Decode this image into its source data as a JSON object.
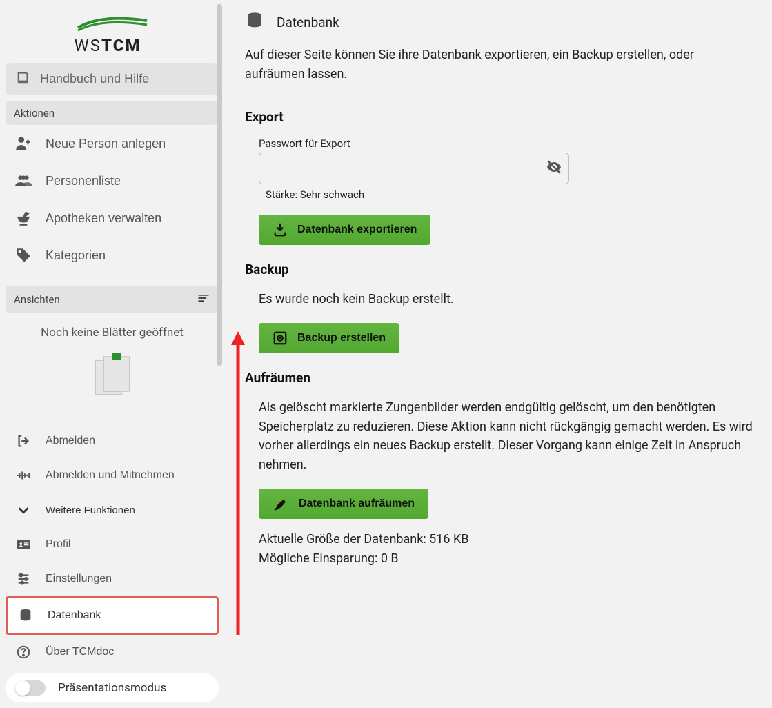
{
  "sidebar": {
    "logo_part1": "WS",
    "logo_part2": "TCM",
    "help_label": "Handbuch und Hilfe",
    "section_actions": "Aktionen",
    "items_actions": [
      {
        "label": "Neue Person anlegen"
      },
      {
        "label": "Personenliste"
      },
      {
        "label": "Apotheken verwalten"
      },
      {
        "label": "Kategorien"
      }
    ],
    "section_views": "Ansichten",
    "views_empty": "Noch keine Blätter geöffnet",
    "items_bottom": [
      {
        "label": "Abmelden"
      },
      {
        "label": "Abmelden und Mitnehmen"
      },
      {
        "label": "Weitere Funktionen"
      },
      {
        "label": "Profil"
      },
      {
        "label": "Einstellungen"
      },
      {
        "label": "Datenbank"
      },
      {
        "label": "Über TCMdoc"
      }
    ],
    "presentation_label": "Präsentationsmodus"
  },
  "page": {
    "title": "Datenbank",
    "description": "Auf dieser Seite können Sie ihre Datenbank exportieren, ein Backup erstellen, oder aufräumen lassen.",
    "export": {
      "heading": "Export",
      "password_label": "Passwort für Export",
      "password_value": "",
      "strength_label": "Stärke: Sehr schwach",
      "button": "Datenbank exportieren"
    },
    "backup": {
      "heading": "Backup",
      "status": "Es wurde noch kein Backup erstellt.",
      "button": "Backup erstellen"
    },
    "cleanup": {
      "heading": "Aufräumen",
      "text": "Als gelöscht markierte Zungenbilder werden endgültig gelöscht, um den benötigten Speicherplatz zu reduzieren. Diese Aktion kann nicht rückgängig gemacht werden. Es wird vorher allerdings ein neues Backup erstellt. Dieser Vorgang kann einige Zeit in Anspruch nehmen.",
      "button": "Datenbank aufräumen",
      "size_label": "Aktuelle Größe der Datenbank: 516 KB",
      "savings_label": "Mögliche Einsparung: 0 B"
    }
  }
}
